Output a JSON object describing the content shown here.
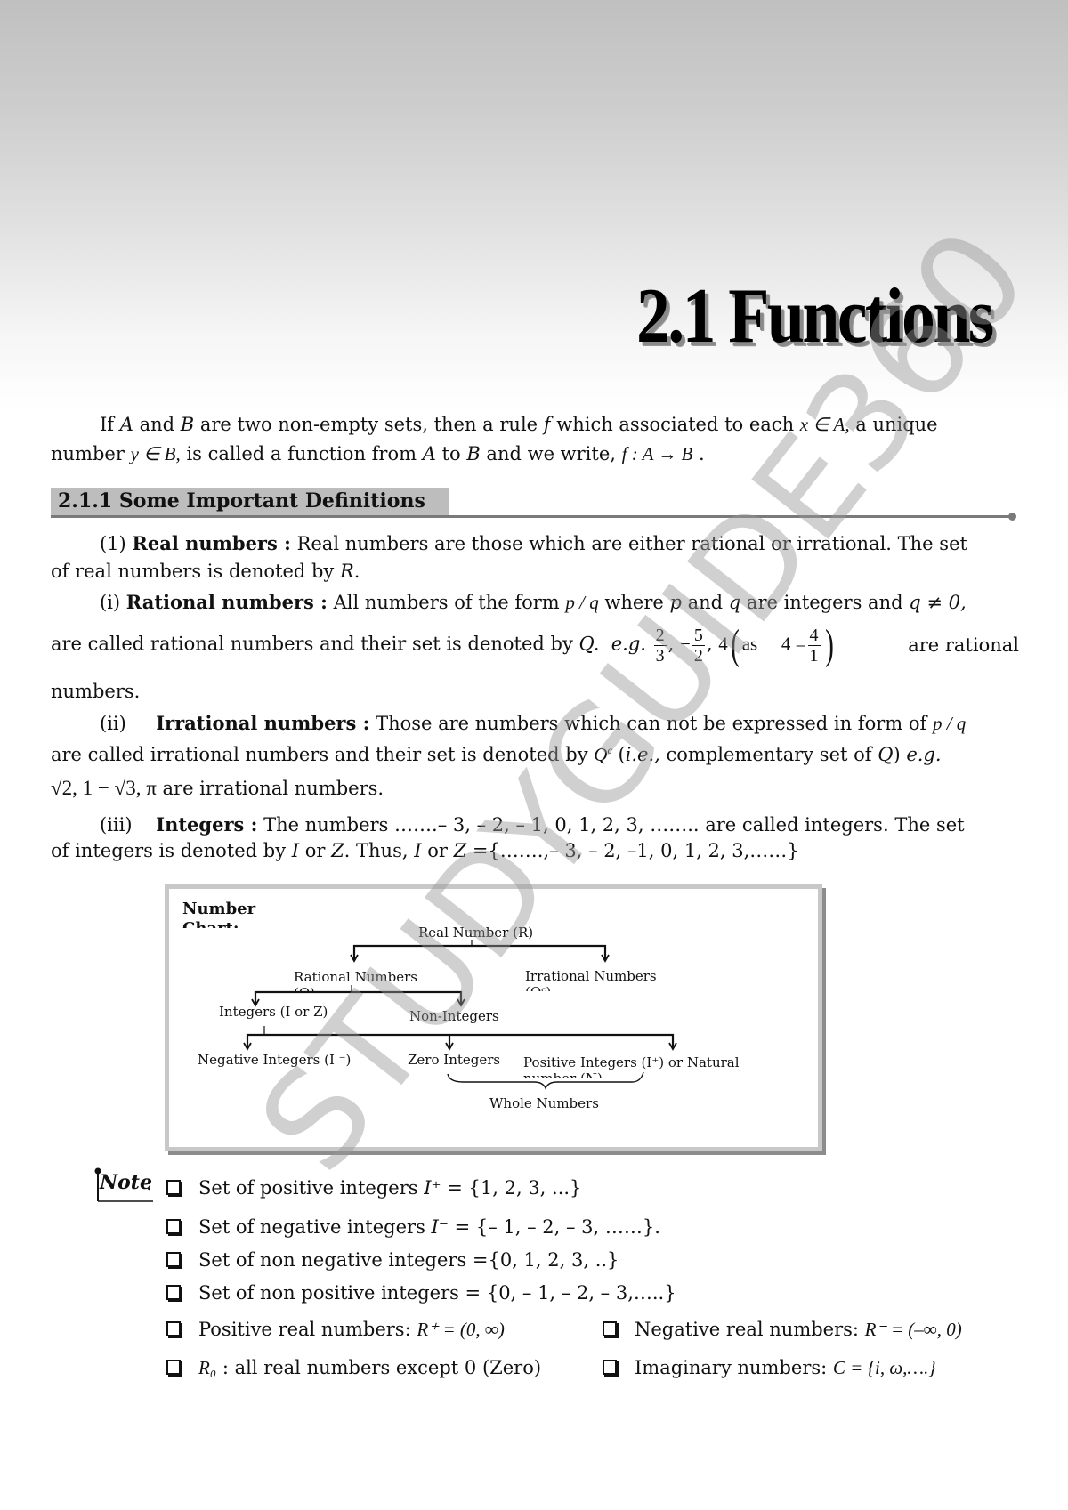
{
  "title": "2.1 Functions",
  "intro": {
    "line1_prefix": "If ",
    "A": "A",
    "and1": " and ",
    "B": "B",
    "line1_mid": " are two non-empty sets, then a rule ",
    "f": "f",
    "line1_mid2": " which associated to each ",
    "x_in_A": "x ∈ A,",
    "line1_end": " a unique",
    "line2_prefix": "number ",
    "y_in_B": "y ∈ B,",
    "line2_mid": " is called a function from ",
    "line2_and": " and we write, ",
    "map": "f : A → B",
    "line2_end": " ."
  },
  "section": {
    "heading": "2.1.1 Some Important Definitions"
  },
  "definitions": {
    "real": {
      "num": "(1) ",
      "term": "Real numbers :",
      "text1": " Real numbers are those which are either rational or irrational. The set",
      "text2": "of real numbers is denoted by ",
      "symbol": "R",
      "end": "."
    },
    "rational": {
      "num": "(i) ",
      "term": "Rational numbers :",
      "text1": " All numbers of the form ",
      "pq": "p / q",
      "text1b": " where ",
      "p": "p",
      "text1c": " and ",
      "q": "q",
      "text1d": " are integers and ",
      "qne0": "q ≠ 0,",
      "text2": "are called rational numbers and their set is denoted by ",
      "Q": "Q.",
      "eg": "e.g.",
      "examples": [
        {
          "num": "2",
          "den": "3"
        },
        {
          "num": "5",
          "den": "2",
          "sign": "−"
        }
      ],
      "four": "4",
      "as": "as",
      "four_eq": "4 =",
      "four_frac": {
        "num": "4",
        "den": "1"
      },
      "text2_end": "are rational",
      "text3": "numbers."
    },
    "irrational": {
      "num": "(ii)",
      "term": "Irrational numbers :",
      "text1": " Those are numbers which can not be expressed in form of ",
      "pq": "p / q",
      "text2a": "are called irrational numbers  and their set is denoted by ",
      "Qc": "Q",
      "Qc_sup": "c",
      "text2b": " (",
      "ie": "i.e.,",
      "text2c": " complementary set of ",
      "Q": "Q",
      "text2d": ") ",
      "eg": "e.g.",
      "examples": "√2,   1 − √3,  π",
      "text3": " are  irrational numbers."
    },
    "integers": {
      "num": "(iii)",
      "term": "Integers :",
      "text1": " The numbers …….– 3, – 2, – 1, 0, 1, 2, 3, …….. are called integers. The set",
      "text2a": "of integers is denoted by ",
      "I": "I",
      "or": " or ",
      "Z": "Z",
      "text2b": ". Thus, ",
      "text2c": " ={…….,– 3, – 2, –1, 0, 1, 2, 3,……}"
    }
  },
  "number_chart": {
    "title_line1": "Number",
    "title_line2": "Chart:",
    "nodes": {
      "real": "Real Number (R)",
      "rational": "Rational Numbers",
      "rational_sub": "(Q)",
      "irrational": "Irrational Numbers",
      "irrational_sub": "(Qᶜ)",
      "integers": "Integers (I or Z)",
      "non_integers": "Non-Integers",
      "negative": "Negative Integers (I ⁻)",
      "zero": "Zero Integers",
      "positive": "Positive Integers (I⁺) or Natural",
      "positive_sub": "number (N)",
      "whole": "Whole Numbers"
    }
  },
  "note": {
    "label": "Note",
    "colon": ":",
    "items": [
      {
        "text": "Set of positive integers ",
        "math": "I⁺",
        "rest": " = {1, 2, 3, ...}"
      },
      {
        "text": "Set of negative integers ",
        "math": "I⁻",
        "rest": " = {– 1, – 2, – 3, ……}."
      },
      {
        "text": "Set of non negative integers ={0, 1, 2, 3, ..}"
      },
      {
        "text": "Set of non positive integers = {0, – 1, – 2, – 3,…..}"
      },
      {
        "text": "Positive real numbers:  ",
        "math": "R⁺ = (0, ∞)"
      },
      {
        "text": "Negative real numbers:  ",
        "math": "R⁻ = (–∞, 0)"
      },
      {
        "math": "R₀",
        "text": " :  all real numbers except 0 (Zero)"
      },
      {
        "text": "Imaginary numbers:  ",
        "math": "C = {i, ω,….}"
      }
    ]
  },
  "watermark": "STUDYGUIDE360",
  "colors": {
    "heading_bg": "#bdbdbd",
    "rule": "#7a7a7a",
    "watermark": "#9c9c9c",
    "chart_border": "#c8c8c8"
  }
}
